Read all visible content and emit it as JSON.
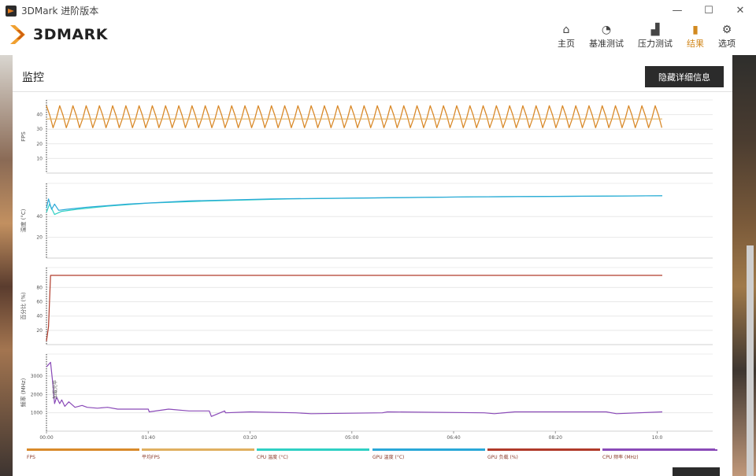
{
  "window": {
    "title": "3DMark 进阶版本",
    "minimize": "—",
    "maximize": "☐",
    "close": "✕"
  },
  "logo": {
    "text": "3DMARK"
  },
  "nav": {
    "items": [
      {
        "label": "主页",
        "icon": "home-icon",
        "glyph": "⌂"
      },
      {
        "label": "基准测试",
        "icon": "gauge-icon",
        "glyph": "◔"
      },
      {
        "label": "压力测试",
        "icon": "bar-chart-icon",
        "glyph": "▟"
      },
      {
        "label": "结果",
        "icon": "results-icon",
        "glyph": "▮"
      },
      {
        "label": "选项",
        "icon": "gear-icon",
        "glyph": "⚙"
      }
    ],
    "active": "结果"
  },
  "panel": {
    "title": "监控",
    "hide_button": "隐藏详细信息"
  },
  "colors": {
    "fps": "#d98a2b",
    "avg_fps": "#e0b060",
    "cpu_temp": "#2fd0c4",
    "gpu_temp": "#2aa8d8",
    "gpu_load": "#b03a2a",
    "cpu_freq": "#8a4ab8",
    "accent": "#d2891f"
  },
  "chart_data": [
    {
      "type": "line",
      "ylabel": "FPS",
      "yticks": [
        10,
        20,
        30,
        40
      ],
      "ylim": [
        0,
        50
      ],
      "xlim": [
        0,
        605
      ],
      "series": [
        {
          "pattern": "oscillating",
          "low": 31,
          "high": 46,
          "period_seconds": 13
        },
        {
          "pattern": "flat",
          "value": 37
        }
      ]
    },
    {
      "type": "line",
      "ylabel": "温度 (°C)",
      "yticks": [
        20,
        40
      ],
      "ylim": [
        0,
        72
      ],
      "xlim": [
        0,
        605
      ],
      "series": [
        {
          "x": [
            0,
            3,
            8,
            15,
            30,
            60,
            100,
            160,
            240,
            330,
            420,
            510,
            605
          ],
          "values": [
            44,
            52,
            42,
            45,
            47,
            50,
            53,
            55,
            57,
            58,
            59,
            59.5,
            60
          ]
        },
        {
          "x": [
            0,
            2,
            5,
            8,
            12,
            20,
            40,
            80,
            140,
            220,
            320,
            420,
            520,
            605
          ],
          "values": [
            48,
            57,
            47,
            52,
            46,
            47,
            49,
            52,
            55,
            57,
            58,
            59,
            59.5,
            60
          ]
        }
      ]
    },
    {
      "type": "line",
      "ylabel": "百分比 (%)",
      "yticks": [
        20,
        40,
        60,
        80
      ],
      "ylim": [
        0,
        108
      ],
      "xlim": [
        0,
        605
      ],
      "series": [
        {
          "x": [
            0,
            2,
            4,
            605
          ],
          "values": [
            5,
            25,
            97,
            97
          ]
        }
      ]
    },
    {
      "type": "line",
      "ylabel": "频率 (MHz)",
      "yticks": [
        1000,
        2000,
        3000
      ],
      "ylim": [
        0,
        4200
      ],
      "xlim": [
        0,
        605
      ],
      "annotation": "加载完毕",
      "series": [
        {
          "x": [
            0,
            4,
            6,
            8,
            10,
            13,
            15,
            18,
            22,
            28,
            35,
            40,
            50,
            60,
            70,
            100,
            101,
            120,
            140,
            160,
            162,
            175,
            176,
            200,
            245,
            260,
            330,
            335,
            430,
            440,
            460,
            550,
            560,
            605
          ],
          "values": [
            3500,
            3750,
            2700,
            1500,
            1850,
            1500,
            1700,
            1350,
            1600,
            1300,
            1400,
            1300,
            1250,
            1300,
            1200,
            1200,
            1050,
            1200,
            1100,
            1100,
            800,
            1100,
            1000,
            1050,
            1000,
            950,
            1000,
            1050,
            1000,
            950,
            1050,
            1050,
            950,
            1050
          ]
        }
      ]
    }
  ],
  "xaxis": {
    "ticks": [
      "00:00",
      "01:40",
      "03:20",
      "05:00",
      "06:40",
      "08:20",
      "10:0"
    ],
    "tick_values": [
      0,
      100,
      200,
      300,
      400,
      500,
      600
    ]
  },
  "legend": [
    {
      "label": "FPS",
      "color": "#d98a2b"
    },
    {
      "label": "平均FPS",
      "color": "#e0b060"
    },
    {
      "label": "CPU 温度 (°C)",
      "color": "#2fd0c4"
    },
    {
      "label": "GPU 温度 (°C)",
      "color": "#2aa8d8"
    },
    {
      "label": "GPU 负载 (%)",
      "color": "#b03a2a"
    },
    {
      "label": "CPU 频率 (MHz)",
      "color": "#8a4ab8"
    }
  ]
}
